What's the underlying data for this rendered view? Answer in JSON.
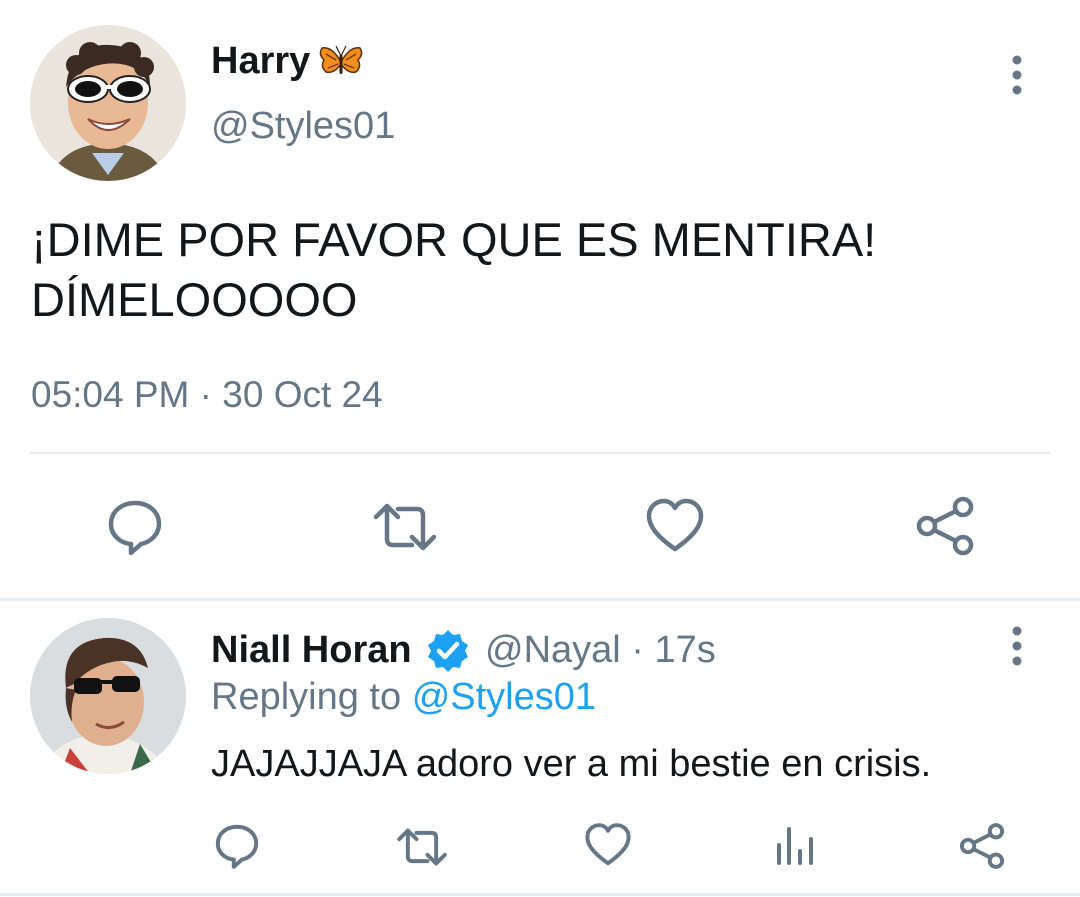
{
  "main_tweet": {
    "display_name": "Harry",
    "name_emoji": "butterfly-emoji",
    "handle": "@Styles01",
    "text_line1": "¡DIME POR FAVOR QUE ES MENTIRA!",
    "text_line2": "DÍMELOOOOO",
    "time": "05:04 PM",
    "separator": "·",
    "date": "30 Oct 24"
  },
  "reply_tweet": {
    "display_name": "Niall Horan",
    "verified": true,
    "handle": "@Nayal",
    "separator": "·",
    "age": "17s",
    "replying_to_label": "Replying to",
    "replying_to_handle": "@Styles01",
    "text": "JAJAJJAJA adoro ver a mi bestie en crisis."
  },
  "icons": {
    "reply": "reply-icon",
    "retweet": "retweet-icon",
    "like": "heart-icon",
    "share": "share-icon",
    "stats": "analytics-icon",
    "more": "more-vertical-icon",
    "verified": "verified-badge-icon"
  },
  "colors": {
    "text_primary": "#14171a",
    "text_secondary": "#657786",
    "link": "#1da1f2",
    "verified": "#1da1f2",
    "divider": "#e6ecf0"
  }
}
